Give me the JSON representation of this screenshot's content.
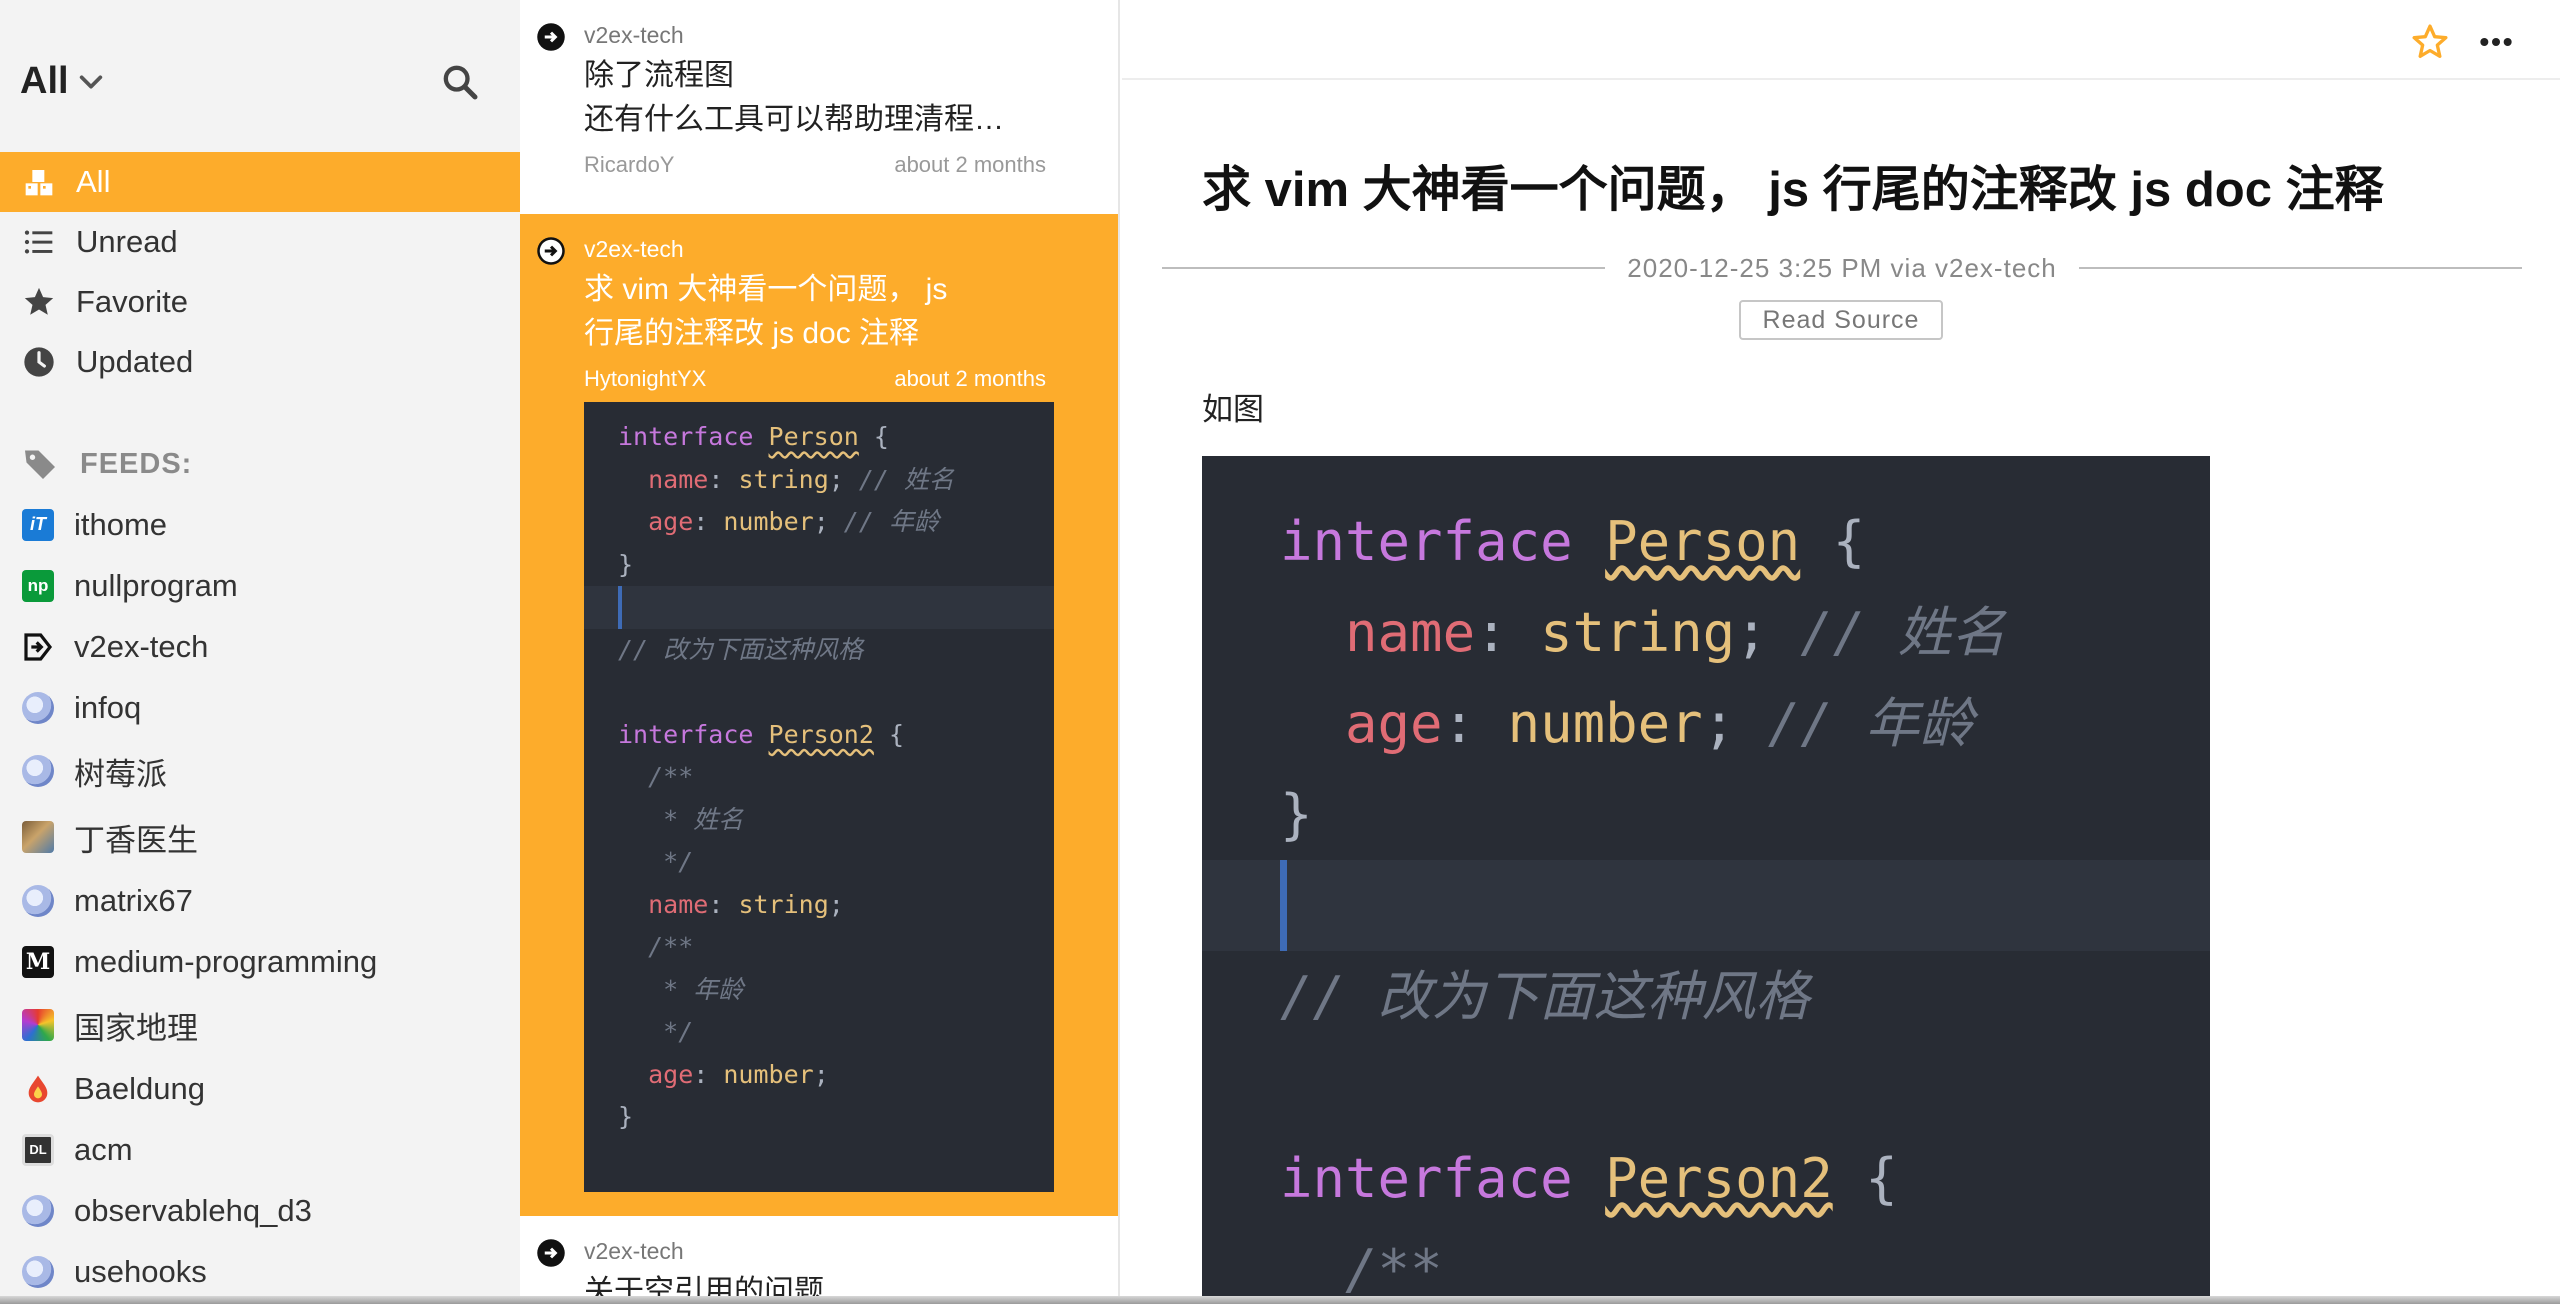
{
  "sidebar": {
    "filter_label": "All",
    "nav": [
      {
        "label": "All",
        "icon": "all-icon",
        "active": true
      },
      {
        "label": "Unread",
        "icon": "list-icon"
      },
      {
        "label": "Favorite",
        "icon": "star-icon"
      },
      {
        "label": "Updated",
        "icon": "clock-icon"
      }
    ],
    "feeds_title": "FEEDS:",
    "feeds": [
      {
        "label": "ithome"
      },
      {
        "label": "nullprogram"
      },
      {
        "label": "v2ex-tech"
      },
      {
        "label": "infoq"
      },
      {
        "label": "树莓派"
      },
      {
        "label": "丁香医生"
      },
      {
        "label": "matrix67"
      },
      {
        "label": "medium-programming"
      },
      {
        "label": "国家地理"
      },
      {
        "label": "Baeldung"
      },
      {
        "label": "acm"
      },
      {
        "label": "observablehq_d3"
      },
      {
        "label": "usehooks"
      }
    ]
  },
  "list": {
    "items": [
      {
        "source": "v2ex-tech",
        "title_line1": "除了流程图",
        "title_line2": "还有什么工具可以帮助理清程…",
        "author": "RicardoY",
        "time": "about 2 months"
      },
      {
        "source": "v2ex-tech",
        "title_line1": "求 vim 大神看一个问题， js",
        "title_line2": "行尾的注释改 js doc 注释",
        "author": "HytonightYX",
        "time": "about 2 months"
      },
      {
        "source": "v2ex-tech",
        "title_line1": "关于空引用的问题"
      }
    ]
  },
  "code": {
    "l1_kw": "interface",
    "l1_ty": "Person",
    "l1_br": " {",
    "l2_pr": "name",
    "l2_sep": ": ",
    "l2_ty": "string",
    "l2_semi": "; ",
    "l2_cm": "// 姓名",
    "l3_pr": "age",
    "l3_sep": ": ",
    "l3_ty": "number",
    "l3_semi": "; ",
    "l3_cm": "// 年龄",
    "l4": "}",
    "l6_cm": "// 改为下面这种风格",
    "l8_kw": "interface",
    "l8_ty": "Person2",
    "l8_br": " {",
    "l9_cm": "/**",
    "l10_cm": " * 姓名",
    "l11_cm": " */",
    "l12_pr": "name",
    "l12_sep": ": ",
    "l12_ty": "string",
    "l12_semi": ";",
    "l13_cm": "/**",
    "l14_cm": " * 年龄",
    "l15_cm": " */",
    "l16_pr": "age",
    "l16_sep": ": ",
    "l16_ty": "number",
    "l16_semi": ";",
    "l17": "}"
  },
  "reader": {
    "title": "求 vim 大神看一个问题， js 行尾的注释改 js doc 注释",
    "meta": "2020-12-25 3:25 PM via v2ex-tech",
    "read_source": "Read Source",
    "paragraph": "如图"
  },
  "colors": {
    "accent": "#fdac2b",
    "code_bg": "#282c34"
  }
}
